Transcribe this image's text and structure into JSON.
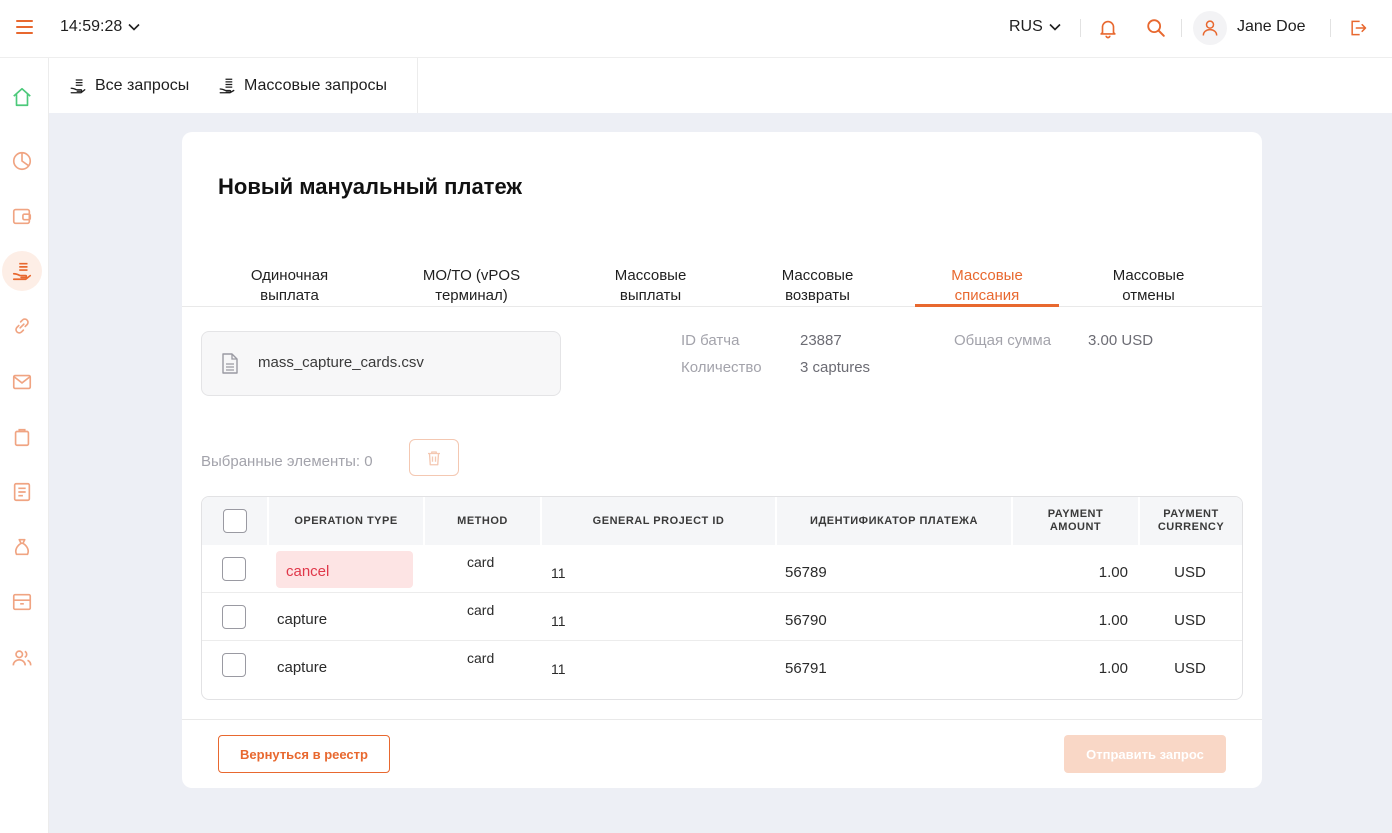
{
  "header": {
    "time": "14:59:28",
    "language": "RUS",
    "user_name": "Jane Doe"
  },
  "subnav": {
    "all_requests": "Все запросы",
    "mass_requests": "Массовые запросы"
  },
  "page": {
    "title": "Новый мануальный платеж",
    "tabs": [
      {
        "line1": "Одиночная",
        "line2": "выплата"
      },
      {
        "line1": "MO/TO (vPOS",
        "line2": "терминал)"
      },
      {
        "line1": "Массовые",
        "line2": "выплаты"
      },
      {
        "line1": "Массовые",
        "line2": "возвраты"
      },
      {
        "line1": "Массовые",
        "line2": "списания"
      },
      {
        "line1": "Массовые",
        "line2": "отмены"
      }
    ],
    "active_tab": 4
  },
  "file": {
    "name": "mass_capture_cards.csv"
  },
  "batch_info": {
    "batch_id_label": "ID батча",
    "batch_id_value": "23887",
    "count_label": "Количество",
    "count_value": "3 captures",
    "total_label": "Общая сумма",
    "total_value": "3.00 USD"
  },
  "selection": {
    "label": "Выбранные элементы: 0"
  },
  "table": {
    "headers": {
      "operation_type": "OPERATION TYPE",
      "method": "METHOD",
      "general_project_id": "GENERAL PROJECT ID",
      "payment_id": "ИДЕНТИФИКАТОР ПЛАТЕЖА",
      "payment_amount_1": "PAYMENT",
      "payment_amount_2": "AMOUNT",
      "payment_currency_1": "PAYMENT",
      "payment_currency_2": "CURRENCY"
    },
    "rows": [
      {
        "operation": "cancel",
        "method": "card",
        "project_id": "11",
        "payment_id": "56789",
        "amount": "1.00",
        "currency": "USD"
      },
      {
        "operation": "capture",
        "method": "card",
        "project_id": "11",
        "payment_id": "56790",
        "amount": "1.00",
        "currency": "USD"
      },
      {
        "operation": "capture",
        "method": "card",
        "project_id": "11",
        "payment_id": "56791",
        "amount": "1.00",
        "currency": "USD"
      }
    ]
  },
  "footer": {
    "back_label": "Вернуться в реестр",
    "send_label": "Отправить запрос"
  },
  "colors": {
    "accent": "#e8682f",
    "error": "#e0384a",
    "home": "#4cc97a"
  }
}
